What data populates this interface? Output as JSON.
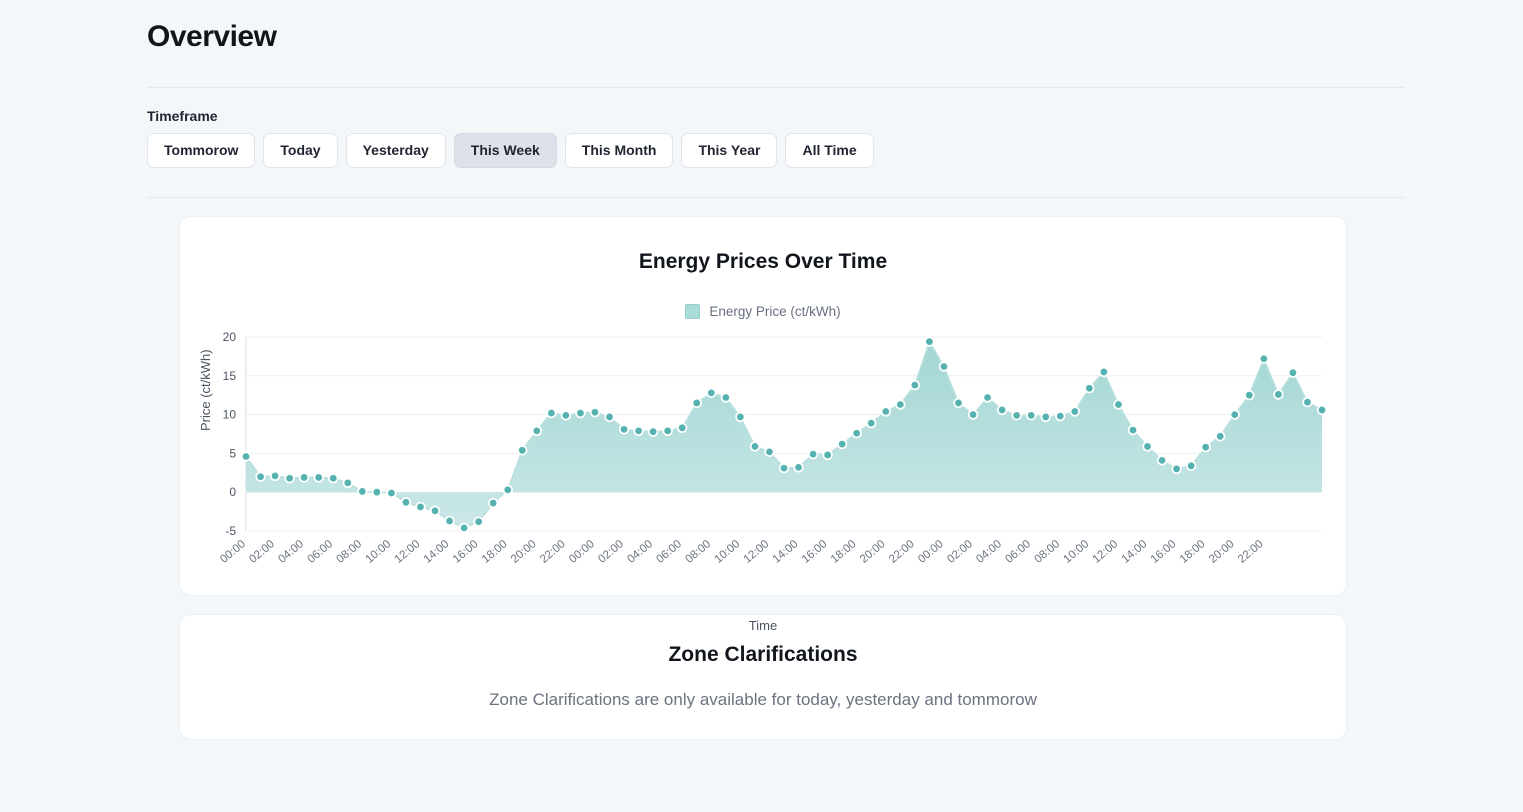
{
  "header": {
    "title": "Overview"
  },
  "timeframe": {
    "label": "Timeframe",
    "selected": "This Week",
    "options": [
      {
        "label": "Tommorow",
        "selected": false
      },
      {
        "label": "Today",
        "selected": false
      },
      {
        "label": "Yesterday",
        "selected": false
      },
      {
        "label": "This Week",
        "selected": true
      },
      {
        "label": "This Month",
        "selected": false
      },
      {
        "label": "This Year",
        "selected": false
      },
      {
        "label": "All Time",
        "selected": false
      }
    ]
  },
  "chart_card": {
    "title": "Energy Prices Over Time",
    "legend_label": "Energy Price (ct/kWh)"
  },
  "info_card": {
    "title": "Zone Clarifications",
    "subtitle": "Zone Clarifications are only available for today, yesterday and tommorow"
  },
  "colors": {
    "accent": "#56b2b0",
    "fill_top": "#a2d6d4",
    "fill_bottom": "#cbe8e7",
    "page_bg": "#f4f7fa",
    "card_bg": "#ffffff",
    "selected_btn": "#dde1e9"
  },
  "chart_data": {
    "type": "area",
    "title": "Energy Prices Over Time",
    "xlabel": "Time",
    "ylabel": "Price (ct/kWh)",
    "ylim": [
      -5,
      20
    ],
    "yticks": [
      20,
      15,
      10,
      5,
      0,
      -5
    ],
    "grid": true,
    "legend_position": "top-center",
    "series_name": "Energy Price (ct/kWh)",
    "x": [
      "00:00",
      "01:00",
      "02:00",
      "03:00",
      "04:00",
      "05:00",
      "06:00",
      "07:00",
      "08:00",
      "09:00",
      "10:00",
      "11:00",
      "12:00",
      "13:00",
      "14:00",
      "15:00",
      "16:00",
      "17:00",
      "18:00",
      "19:00",
      "20:00",
      "21:00",
      "22:00",
      "23:00",
      "00:00",
      "01:00",
      "02:00",
      "03:00",
      "04:00",
      "05:00",
      "06:00",
      "07:00",
      "08:00",
      "09:00",
      "10:00",
      "11:00",
      "12:00",
      "13:00",
      "14:00",
      "15:00",
      "16:00",
      "17:00",
      "18:00",
      "19:00",
      "20:00",
      "21:00",
      "22:00",
      "23:00",
      "00:00",
      "01:00",
      "02:00",
      "03:00",
      "04:00",
      "05:00",
      "06:00",
      "07:00",
      "08:00",
      "09:00",
      "10:00",
      "11:00",
      "12:00",
      "13:00",
      "14:00",
      "15:00",
      "16:00",
      "17:00",
      "18:00",
      "19:00",
      "20:00",
      "21:00",
      "22:00",
      "23:00"
    ],
    "xtick_labels": [
      "00:00",
      "02:00",
      "04:00",
      "06:00",
      "08:00",
      "10:00",
      "12:00",
      "14:00",
      "16:00",
      "18:00",
      "20:00",
      "22:00",
      "00:00",
      "02:00",
      "04:00",
      "06:00",
      "08:00",
      "10:00",
      "12:00",
      "14:00",
      "16:00",
      "18:00",
      "20:00",
      "22:00",
      "00:00",
      "02:00",
      "04:00",
      "06:00",
      "08:00",
      "10:00",
      "12:00",
      "14:00",
      "16:00",
      "18:00",
      "20:00",
      "22:00"
    ],
    "values": [
      4.6,
      2.0,
      2.1,
      1.8,
      1.9,
      1.9,
      1.8,
      1.2,
      0.1,
      0.0,
      -0.1,
      -1.3,
      -1.9,
      -2.4,
      -3.7,
      -4.6,
      -3.8,
      -1.4,
      0.3,
      5.4,
      7.9,
      10.2,
      9.9,
      10.2,
      10.3,
      9.7,
      8.1,
      7.9,
      7.8,
      7.9,
      8.3,
      11.5,
      12.8,
      12.2,
      9.7,
      5.9,
      5.2,
      3.1,
      3.2,
      4.9,
      4.8,
      6.2,
      7.6,
      8.9,
      10.4,
      11.3,
      13.8,
      19.4,
      16.2,
      11.5,
      10.0,
      12.2,
      10.6,
      9.9,
      9.9,
      9.7,
      9.8,
      10.4,
      13.4,
      15.5,
      11.3,
      8.0,
      5.9,
      4.1,
      3.0,
      3.4,
      5.8,
      7.2,
      10.0,
      12.5,
      17.2,
      12.6
    ],
    "values_tail": [
      15.4,
      11.6,
      10.6
    ],
    "max_value": 19.4,
    "min_value": -4.6
  }
}
